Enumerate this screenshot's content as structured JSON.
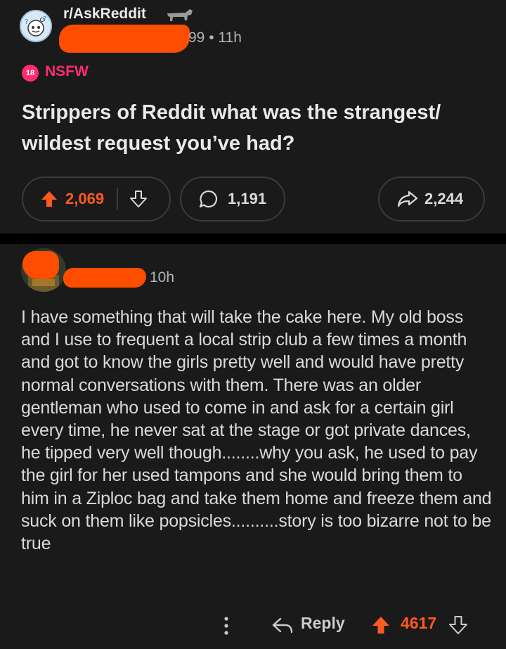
{
  "post": {
    "subreddit": "r/AskReddit",
    "author_visible_tail": "99",
    "separator": "•",
    "age": "11h",
    "nsfw_badge_text": "18",
    "nsfw_label": "NSFW",
    "title": "Strippers of Reddit what was the strangest/ wildest request you’ve had?",
    "score": "2,069",
    "comments": "1,191",
    "shares": "2,244"
  },
  "comment": {
    "age": "10h",
    "body": "I have something that will take the cake here. My old boss and I use to frequent a local strip club a few times a month and got to know the girls pretty well and would have pretty normal conversations with them. There was an older gentleman who used to come in and ask for a certain girl every time, he never sat at the stage or got private dances, he tipped very well though........why you ask, he used to pay the girl for her used tampons and she would bring them to him in a Ziploc bag and take them home and freeze them and suck on them like popsicles..........story is too bizarre not to be true",
    "reply_label": "Reply",
    "score": "4617"
  },
  "colors": {
    "upvote_orange": "#ff5a1f",
    "nsfw_pink": "#ff2d6f",
    "redaction_orange": "#ff4d00",
    "background": "#1a1a1b"
  },
  "icons": [
    "subreddit-icon",
    "upvote-icon",
    "downvote-icon",
    "comment-icon",
    "share-icon",
    "more-icon",
    "reply-icon"
  ]
}
